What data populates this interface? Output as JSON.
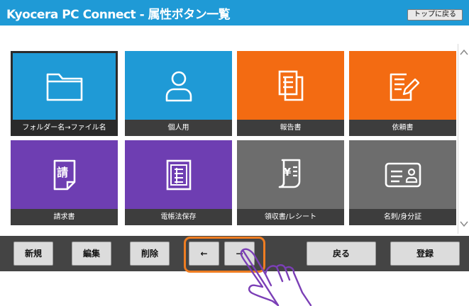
{
  "header": {
    "title": "Kyocera PC Connect - 属性ボタン一覧",
    "back_to_top": "トップに戻る"
  },
  "tiles": [
    {
      "label": "フォルダー名→ファイル名",
      "color": "#1f9ad6",
      "icon": "folder-icon",
      "selected": true
    },
    {
      "label": "個人用",
      "color": "#1f9ad6",
      "icon": "person-icon"
    },
    {
      "label": "報告書",
      "color": "#f36b12",
      "icon": "report-document-icon"
    },
    {
      "label": "依頼書",
      "color": "#f36b12",
      "icon": "request-document-pen-icon"
    },
    {
      "label": "請求書",
      "color": "#6e3eb2",
      "icon": "invoice-document-icon",
      "icon_text": "請"
    },
    {
      "label": "電帳法保存",
      "color": "#6e3eb2",
      "icon": "ledger-document-icon"
    },
    {
      "label": "領収書/レシート",
      "color": "#6d6d6d",
      "icon": "receipt-icon",
      "icon_text": "¥"
    },
    {
      "label": "名刺/身分証",
      "color": "#6d6d6d",
      "icon": "id-card-icon"
    }
  ],
  "toolbar": {
    "new": "新規",
    "edit": "編集",
    "delete": "削除",
    "prev": "←",
    "next": "→",
    "back": "戻る",
    "register": "登録"
  },
  "colors": {
    "header": "#1f9ad6",
    "highlight": "#ef7d22",
    "hand": "#7b3fb6"
  }
}
